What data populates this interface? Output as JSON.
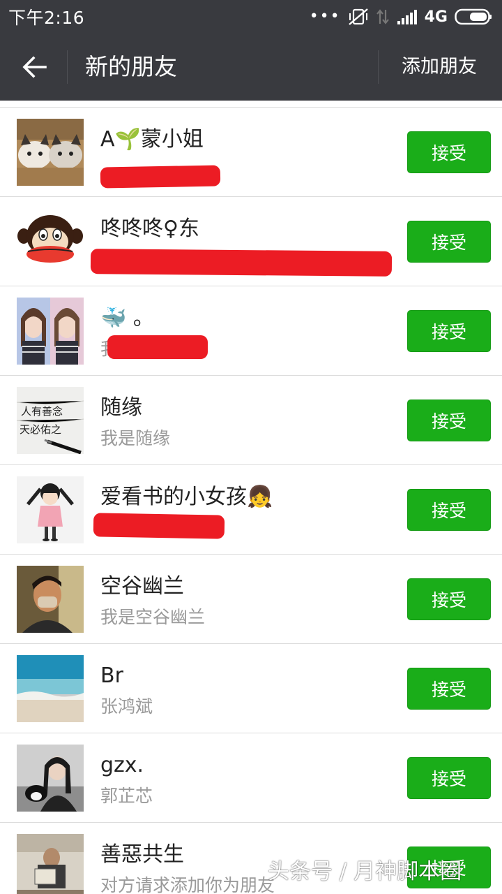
{
  "status_bar": {
    "time": "下午2:16",
    "dots": "•••",
    "network": "4G"
  },
  "nav": {
    "title": "新的朋友",
    "action": "添加朋友"
  },
  "colors": {
    "header_bg": "#393a3f",
    "accept_green": "#1aad19",
    "redaction_red": "#ec1c24"
  },
  "requests": [
    {
      "name": "A🌱蒙小姐",
      "subtitle": "",
      "button": "接受"
    },
    {
      "name": "咚咚咚♀东",
      "subtitle": "",
      "button": "接受"
    },
    {
      "name": "🐳 。",
      "subtitle": "我",
      "button": "接受"
    },
    {
      "name": "随缘",
      "subtitle": "我是随缘",
      "button": "接受"
    },
    {
      "name": "爱看书的小女孩👧",
      "subtitle": "",
      "button": "接受"
    },
    {
      "name": "空谷幽兰",
      "subtitle": "我是空谷幽兰",
      "button": "接受"
    },
    {
      "name": "Br",
      "subtitle": "张鸿斌",
      "button": "接受"
    },
    {
      "name": "gzx.",
      "subtitle": "郭芷芯",
      "button": "接受"
    },
    {
      "name": "善惡共生",
      "subtitle": "对方请求添加你为朋友",
      "button": "接受"
    }
  ],
  "avatar_text": {
    "calligraphy_line1": "人有善念",
    "calligraphy_line2": "天必佑之"
  },
  "watermark": "头条号 / 月神脚本圈"
}
